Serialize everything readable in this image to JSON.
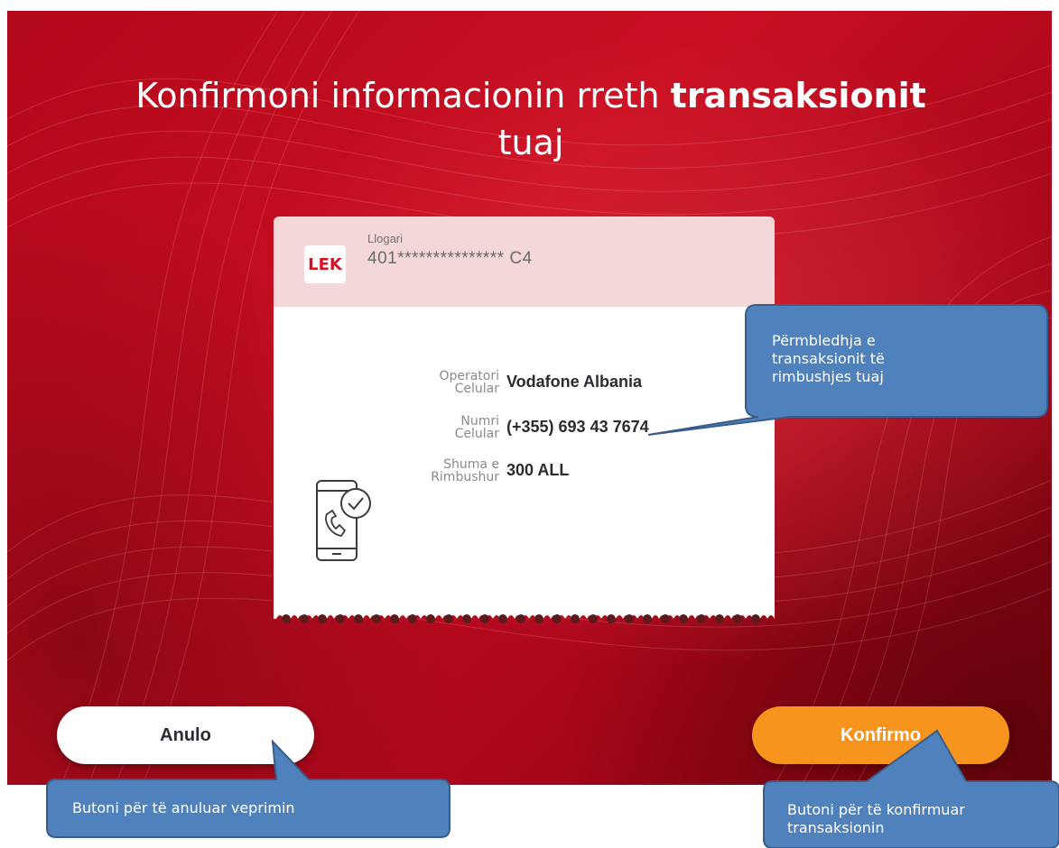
{
  "title": {
    "normal": "Konfirmoni informacionin rreth ",
    "bold": "transaksionit",
    "line2": "tuaj"
  },
  "account": {
    "badge": "LEK",
    "label": "Llogari",
    "number": "401*************** C4"
  },
  "details": [
    {
      "label_line1": "Operatori",
      "label_line2": "Celular",
      "value": "Vodafone Albania"
    },
    {
      "label_line1": "Numri",
      "label_line2": "Celular",
      "value": "(+355) 693 43 7674"
    },
    {
      "label_line1": "Shuma e",
      "label_line2": "Rimbushur",
      "value": "300 ALL"
    }
  ],
  "buttons": {
    "cancel": "Anulo",
    "confirm": "Konfirmo"
  },
  "callouts": {
    "summary": [
      "Përmbledhja e",
      "transaksionit të",
      "rimbushjes tuaj"
    ],
    "cancel": [
      "Butoni për të anuluar veprimin"
    ],
    "confirm": [
      "Butoni për të konfirmuar",
      "transaksionin"
    ]
  },
  "colors": {
    "background": "#c90f22",
    "confirm_button": "#f7941d",
    "callout_fill": "#4f81bd",
    "callout_border": "#385d8a"
  },
  "icons": {
    "phone": "phone-check-icon"
  }
}
